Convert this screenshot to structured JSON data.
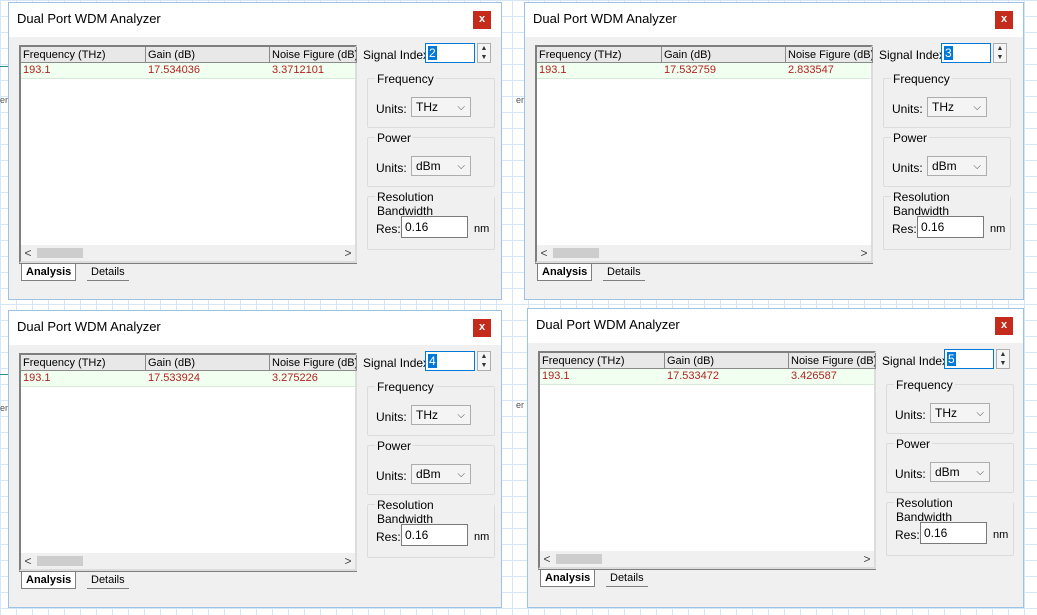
{
  "dialogs": [
    {
      "title": "Dual Port WDM Analyzer",
      "signal_index": "2",
      "row": {
        "frequency": "193.1",
        "gain": "17.534036",
        "nf": "3.3712101"
      }
    },
    {
      "title": "Dual Port WDM Analyzer",
      "signal_index": "3",
      "row": {
        "frequency": "193.1",
        "gain": "17.532759",
        "nf": "2.833547"
      }
    },
    {
      "title": "Dual Port WDM Analyzer",
      "signal_index": "4",
      "row": {
        "frequency": "193.1",
        "gain": "17.533924",
        "nf": "3.275226"
      }
    },
    {
      "title": "Dual Port WDM Analyzer",
      "signal_index": "5",
      "row": {
        "frequency": "193.1",
        "gain": "17.533472",
        "nf": "3.426587"
      }
    }
  ],
  "labels": {
    "close": "x",
    "col_frequency": "Frequency (THz)",
    "col_gain": "Gain (dB)",
    "col_nf": "Noise Figure (dB)",
    "signal_index": "Signal Index:",
    "frequency_group": "Frequency",
    "power_group": "Power",
    "resolution_group": "Resolution Bandwidth",
    "units": "Units:",
    "freq_units": "THz",
    "power_units": "dBm",
    "res": "Res:",
    "res_value": "0.16",
    "nm": "nm",
    "tab_analysis": "Analysis",
    "tab_details": "Details",
    "scroll_left": "<",
    "scroll_right": ">",
    "edge_text": "er"
  },
  "colors": {
    "accent": "#0078d7",
    "close": "#c42b1c",
    "value_text": "#b22222",
    "row_bg": "#f0fff0"
  },
  "icons": [
    "close-icon",
    "spin-up-icon",
    "spin-down-icon",
    "dropdown-caret-icon",
    "scroll-left-icon",
    "scroll-right-icon"
  ]
}
